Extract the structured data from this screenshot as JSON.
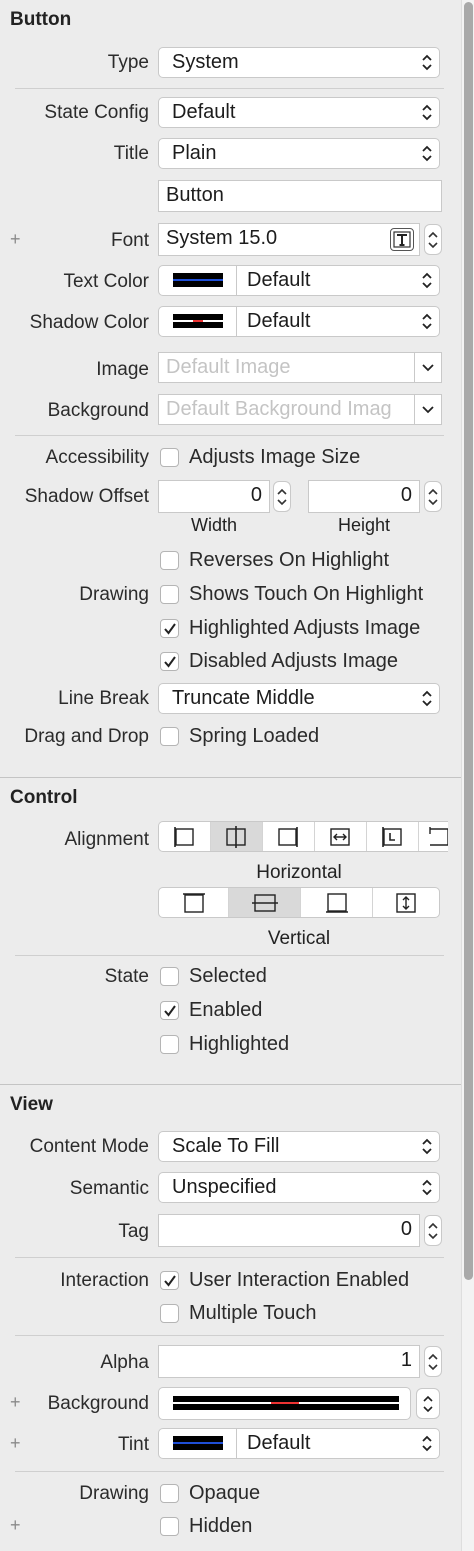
{
  "button": {
    "title": "Button",
    "type_label": "Type",
    "type_value": "System",
    "state_config_label": "State Config",
    "state_config_value": "Default",
    "title_label": "Title",
    "title_value": "Plain",
    "title_text_value": "Button",
    "font_label": "Font",
    "font_value": "System 15.0",
    "text_color_label": "Text Color",
    "text_color_value": "Default",
    "shadow_color_label": "Shadow Color",
    "shadow_color_value": "Default",
    "image_label": "Image",
    "image_placeholder": "Default Image",
    "background_label": "Background",
    "background_placeholder": "Default Background Imag",
    "accessibility_label": "Accessibility",
    "adjusts_image_size": "Adjusts Image Size",
    "shadow_offset_label": "Shadow Offset",
    "shadow_width_value": "0",
    "shadow_height_value": "0",
    "width_caption": "Width",
    "height_caption": "Height",
    "reverses_on_highlight": "Reverses On Highlight",
    "drawing_label": "Drawing",
    "shows_touch_on_highlight": "Shows Touch On Highlight",
    "highlighted_adjusts_image": "Highlighted Adjusts Image",
    "disabled_adjusts_image": "Disabled Adjusts Image",
    "line_break_label": "Line Break",
    "line_break_value": "Truncate Middle",
    "drag_drop_label": "Drag and Drop",
    "spring_loaded": "Spring Loaded",
    "plus": "+"
  },
  "control": {
    "title": "Control",
    "alignment_label": "Alignment",
    "horizontal_caption": "Horizontal",
    "vertical_caption": "Vertical",
    "state_label": "State",
    "selected": "Selected",
    "enabled": "Enabled",
    "highlighted": "Highlighted"
  },
  "view": {
    "title": "View",
    "content_mode_label": "Content Mode",
    "content_mode_value": "Scale To Fill",
    "semantic_label": "Semantic",
    "semantic_value": "Unspecified",
    "tag_label": "Tag",
    "tag_value": "0",
    "interaction_label": "Interaction",
    "user_interaction_enabled": "User Interaction Enabled",
    "multiple_touch": "Multiple Touch",
    "alpha_label": "Alpha",
    "alpha_value": "1",
    "background_label": "Background",
    "tint_label": "Tint",
    "tint_value": "Default",
    "drawing_label": "Drawing",
    "opaque": "Opaque",
    "hidden": "Hidden",
    "plus": "+"
  },
  "colors": {
    "text_color_swatch": "#1f4fd8",
    "panel_bg": "#ececec"
  }
}
